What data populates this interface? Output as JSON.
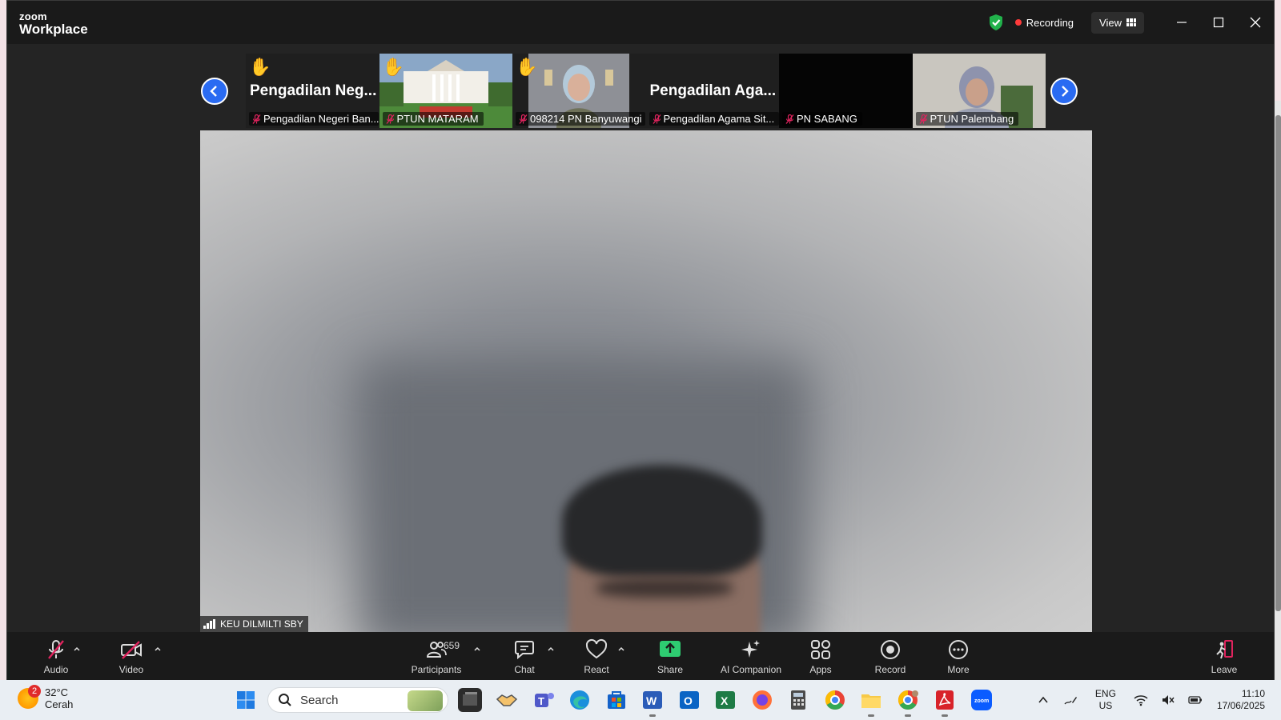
{
  "app": {
    "logo_line1": "zoom",
    "logo_line2": "Workplace"
  },
  "titlebar": {
    "recording_label": "Recording",
    "view_label": "View"
  },
  "gallery": {
    "tiles": [
      {
        "big_name": "Pengadilan  Neg...",
        "label": "Pengadilan Negeri Ban...",
        "hand": "✋",
        "bg": "#1f1f1f"
      },
      {
        "big_name": "",
        "label": "PTUN MATARAM",
        "hand": "✋",
        "bg": "image-building"
      },
      {
        "big_name": "",
        "label": "098214 PN Banyuwangi",
        "hand": "✋",
        "bg": "image-person"
      },
      {
        "big_name": "Pengadilan  Aga...",
        "label": "Pengadilan Agama Sit...",
        "hand": "",
        "bg": "#1f1f1f"
      },
      {
        "big_name": "",
        "label": "PN SABANG",
        "hand": "",
        "bg": "#050505"
      },
      {
        "big_name": "",
        "label": "PTUN Palembang",
        "hand": "",
        "bg": "image-person2"
      }
    ]
  },
  "main_video": {
    "name": "KEU DILMILTI SBY"
  },
  "toolbar": {
    "audio": "Audio",
    "video": "Video",
    "participants": "Participants",
    "participants_count": "659",
    "chat": "Chat",
    "react": "React",
    "share": "Share",
    "ai_companion": "AI Companion",
    "apps": "Apps",
    "record": "Record",
    "more": "More",
    "leave": "Leave"
  },
  "taskbar": {
    "weather_badge": "2",
    "temperature": "32°C",
    "condition": "Cerah",
    "search_placeholder": "Search",
    "lang_line1": "ENG",
    "lang_line2": "US",
    "time": "11:10",
    "date": "17/06/2025"
  },
  "colors": {
    "accent": "#2a6bf2",
    "share_green": "#2ecc71",
    "rec_red": "#ff3b3b",
    "mute_red": "#e0245e"
  }
}
